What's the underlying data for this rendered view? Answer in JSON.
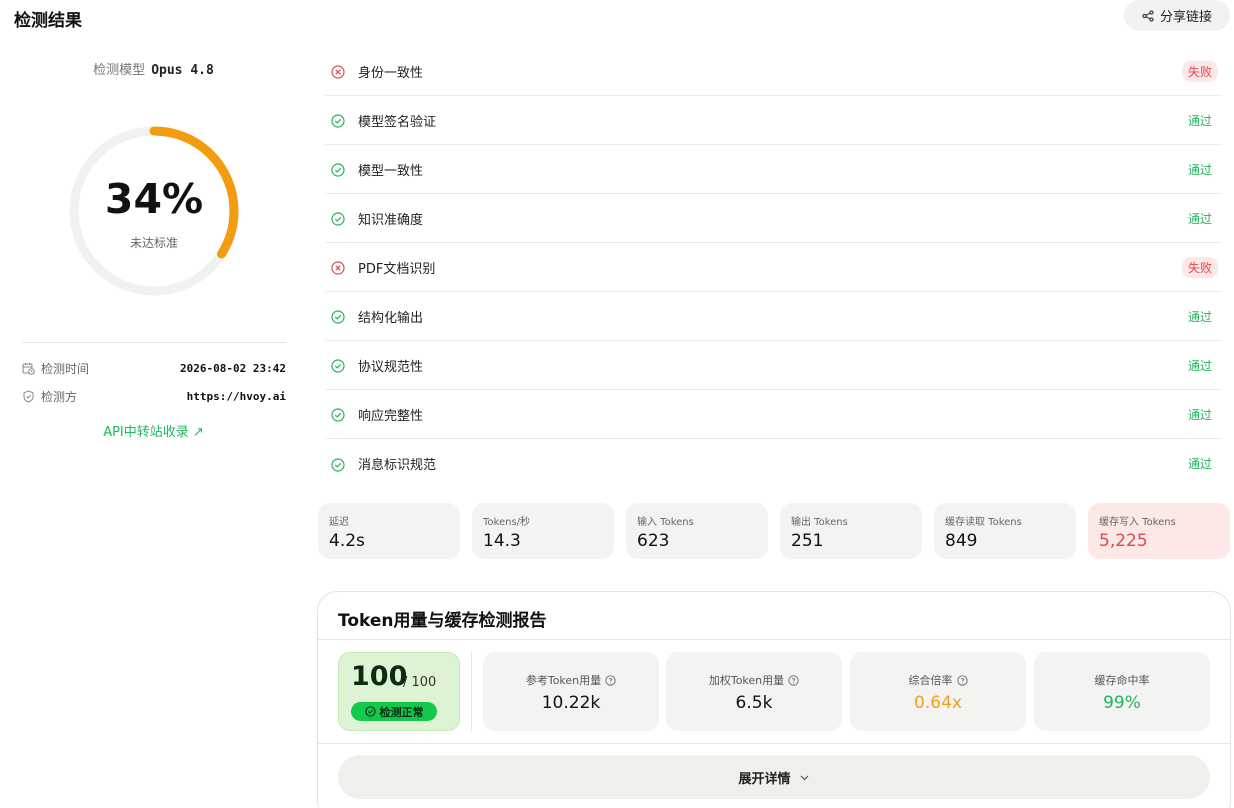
{
  "header": {
    "title": "检测结果",
    "share_label": "分享链接"
  },
  "summary": {
    "model_label": "检测模型",
    "model_name": "Opus 4.8",
    "score_percent": 34,
    "score_text": "34%",
    "score_status": "未达标准",
    "time_label": "检测时间",
    "time_value": "2026-08-02 23:42",
    "detector_label": "检测方",
    "detector_value": "https://hvoy.ai",
    "api_link": "API中转站收录 ↗",
    "colors": {
      "gauge_fill": "#f39c0f",
      "gauge_track": "#f0f1f3"
    }
  },
  "checks": [
    {
      "name": "身份一致性",
      "status": "失败",
      "state": "fail"
    },
    {
      "name": "模型签名验证",
      "status": "通过",
      "state": "pass"
    },
    {
      "name": "模型一致性",
      "status": "通过",
      "state": "pass"
    },
    {
      "name": "知识准确度",
      "status": "通过",
      "state": "pass"
    },
    {
      "name": "PDF文档识别",
      "status": "失败",
      "state": "fail"
    },
    {
      "name": "结构化输出",
      "status": "通过",
      "state": "pass"
    },
    {
      "name": "协议规范性",
      "status": "通过",
      "state": "pass"
    },
    {
      "name": "响应完整性",
      "status": "通过",
      "state": "pass"
    },
    {
      "name": "消息标识规范",
      "status": "通过",
      "state": "pass"
    }
  ],
  "metrics": [
    {
      "label": "延迟",
      "value": "4.2s"
    },
    {
      "label": "Tokens/秒",
      "value": "14.3"
    },
    {
      "label": "输入 Tokens",
      "value": "623"
    },
    {
      "label": "输出 Tokens",
      "value": "251"
    },
    {
      "label": "缓存读取 Tokens",
      "value": "849"
    },
    {
      "label": "缓存写入 Tokens",
      "value": "5,225"
    }
  ],
  "report": {
    "title": "Token用量与缓存检测报告",
    "score": "100",
    "score_total": "/ 100",
    "score_badge": "检测正常",
    "stats": [
      {
        "label": "参考Token用量",
        "value": "10.22k"
      },
      {
        "label": "加权Token用量",
        "value": "6.5k"
      },
      {
        "label": "综合倍率",
        "value": "0.64x"
      },
      {
        "label": "缓存命中率",
        "value": "99%"
      }
    ],
    "expand_label": "展开详情"
  }
}
